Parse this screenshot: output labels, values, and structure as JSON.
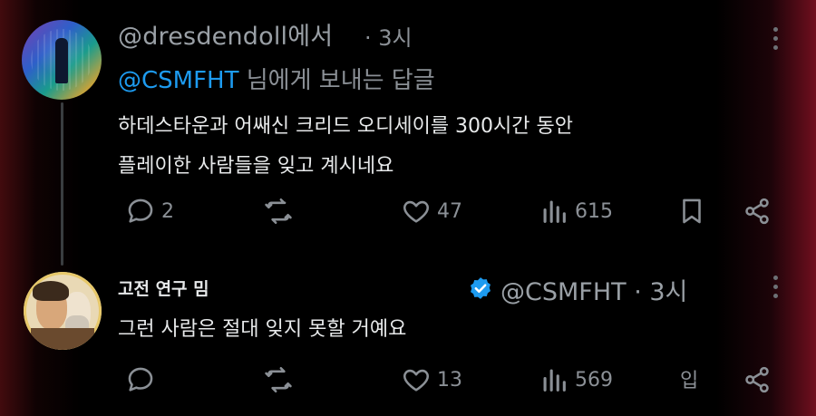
{
  "tweet1": {
    "handle": "@dresdendoll에서",
    "time": "· 3시",
    "reply_mention": "@CSMFHT",
    "reply_rest": " 님에게 보내는 답글",
    "body_line1": "하데스타운과 어쌔신 크리드 오디세이를 300시간 동안",
    "body_line2": "플레이한 사람들을 잊고 계시네요",
    "replies": "2",
    "retweets": "",
    "likes": "47",
    "views": "615"
  },
  "tweet2": {
    "name": "고전 연구 밈",
    "handle": "@CSMFHT · 3시",
    "body": "그런 사람은 절대 잊지 못할 거예요",
    "replies": "",
    "retweets": "",
    "likes": "13",
    "views": "569",
    "extra_label": "입"
  },
  "icons": {
    "reply": "reply-icon",
    "retweet": "retweet-icon",
    "like": "heart-icon",
    "views": "views-icon",
    "bookmark": "bookmark-icon",
    "share": "share-icon",
    "verified": "verified-badge-icon",
    "more": "more-options-icon"
  },
  "colors": {
    "accent": "#1d9bf0",
    "muted": "#8b9096",
    "text": "#e7e9ea",
    "background": "#000000"
  }
}
